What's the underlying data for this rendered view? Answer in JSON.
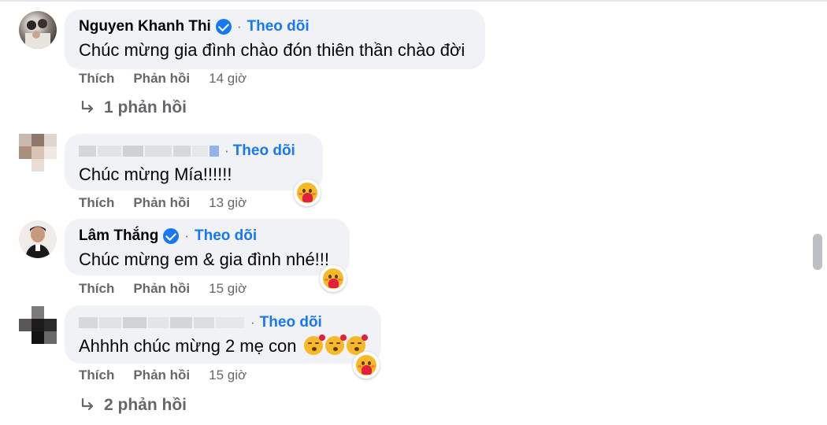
{
  "follow_label": "Theo dõi",
  "separator": "·",
  "comments": [
    {
      "author": "Nguyen Khanh Thi",
      "verified": true,
      "text": "Chúc mừng gia đình chào đón thiên thần chào đời",
      "like_label": "Thích",
      "reply_label": "Phản hồi",
      "time": "14 giờ",
      "replies_label": "1 phản hồi"
    },
    {
      "author_blurred": true,
      "text": "Chúc mừng Mía!!!!!!",
      "like_label": "Thích",
      "reply_label": "Phản hồi",
      "time": "13 giờ",
      "reaction": "care-emoji"
    },
    {
      "author": "Lâm Thắng",
      "verified": true,
      "text": "Chúc mừng em & gia đình nhé!!!",
      "like_label": "Thích",
      "reply_label": "Phản hồi",
      "time": "15 giờ",
      "reaction": "care-emoji"
    },
    {
      "author_blurred": true,
      "text": "Ahhhh chúc mừng 2 mẹ con",
      "trailing_emojis": [
        "kiss-emoji",
        "kiss-emoji",
        "kiss-emoji"
      ],
      "like_label": "Thích",
      "reply_label": "Phản hồi",
      "time": "15 giờ",
      "reaction": "care-emoji",
      "replies_label": "2 phản hồi"
    }
  ],
  "colors": {
    "bubble": "#f0f2f5",
    "link": "#1877f2",
    "muted": "#65676b"
  }
}
